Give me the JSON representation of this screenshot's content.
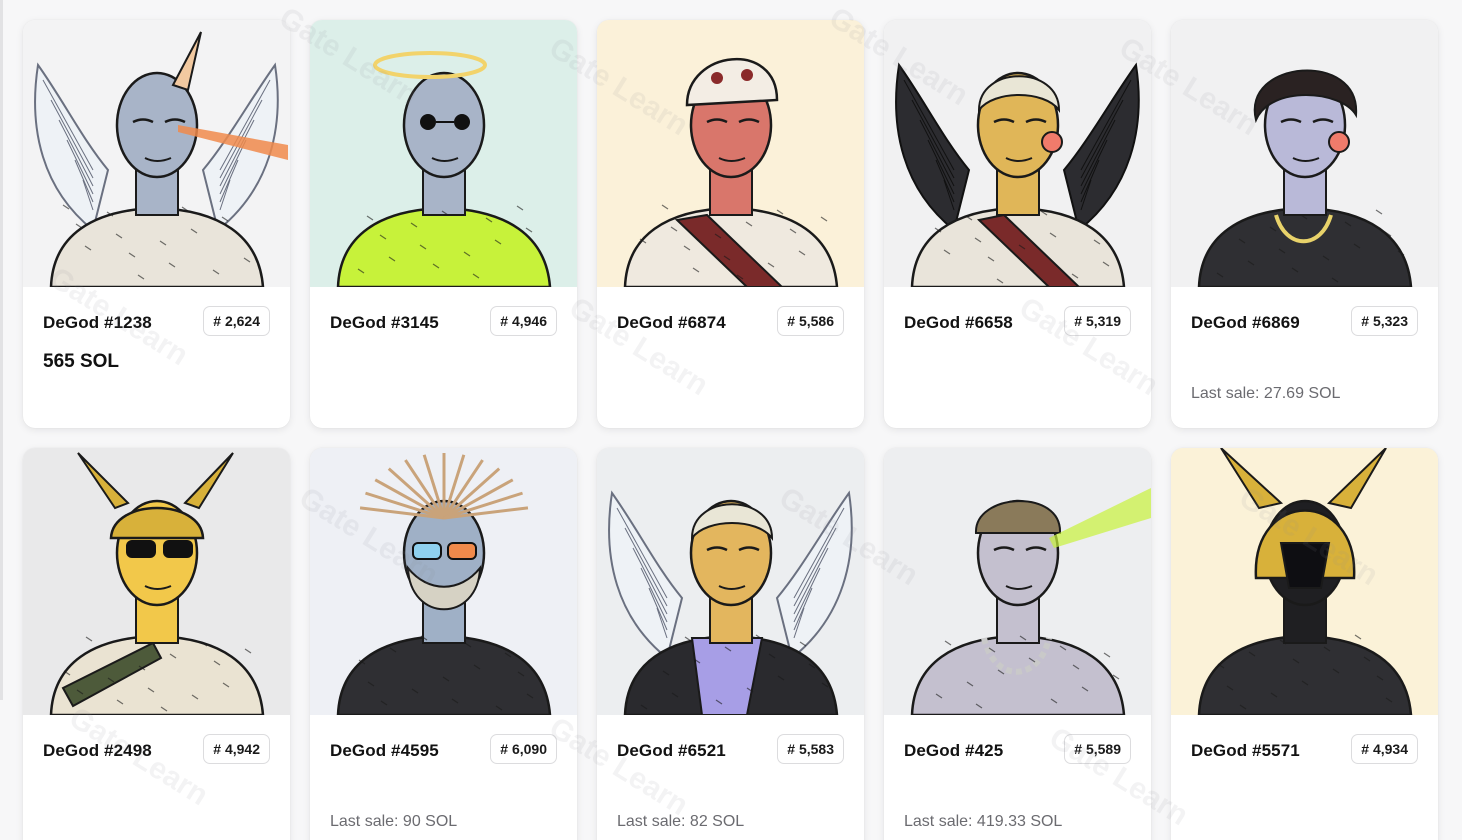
{
  "cards": [
    {
      "name": "DeGod #1238",
      "rank": "# 2,624",
      "price": "565 SOL",
      "last_sale": "",
      "bg": "#f3f3f4",
      "skin": "#a8b4c8",
      "theme": "wings-horn"
    },
    {
      "name": "DeGod #3145",
      "rank": "# 4,946",
      "price": "",
      "last_sale": "",
      "bg": "#dcefe9",
      "skin": "#a8b4c8",
      "theme": "halo-green"
    },
    {
      "name": "DeGod #6874",
      "rank": "# 5,586",
      "price": "",
      "last_sale": "",
      "bg": "#fbf1d9",
      "skin": "#d9766b",
      "theme": "skull-hat"
    },
    {
      "name": "DeGod #6658",
      "rank": "# 5,319",
      "price": "",
      "last_sale": "",
      "bg": "#f1f1f2",
      "skin": "#e0b658",
      "theme": "dark-wings"
    },
    {
      "name": "DeGod #6869",
      "rank": "# 5,323",
      "price": "",
      "last_sale": "Last sale: 27.69 SOL",
      "bg": "#f1f1f2",
      "skin": "#b9b9d8",
      "theme": "curly-vest"
    },
    {
      "name": "DeGod #2498",
      "rank": "# 4,942",
      "price": "",
      "last_sale": "",
      "bg": "#e9e9ea",
      "skin": "#f2c84a",
      "theme": "gold-helmet-shades"
    },
    {
      "name": "DeGod #4595",
      "rank": "# 6,090",
      "price": "",
      "last_sale": "Last sale: 90 SOL",
      "bg": "#eef0f5",
      "skin": "#9fb0c6",
      "theme": "spiky-beard"
    },
    {
      "name": "DeGod #6521",
      "rank": "# 5,583",
      "price": "",
      "last_sale": "Last sale: 82 SOL",
      "bg": "#eceef0",
      "skin": "#e3b65e",
      "theme": "wings-scarf"
    },
    {
      "name": "DeGod #425",
      "rank": "# 5,589",
      "price": "",
      "last_sale": "Last sale: 419.33 SOL",
      "bg": "#edeef0",
      "skin": "#c4c0cf",
      "theme": "chain-laser"
    },
    {
      "name": "DeGod #5571",
      "rank": "# 4,934",
      "price": "",
      "last_sale": "",
      "bg": "#fbf2d8",
      "skin": "#2a2a2a",
      "theme": "gold-visor"
    }
  ],
  "watermark_text": "Gate Learn",
  "colors": {
    "accent_gold": "#d8b13a",
    "halo": "#f2d36b",
    "laser": "#f08a4b",
    "neon_green": "#c7f23a"
  }
}
